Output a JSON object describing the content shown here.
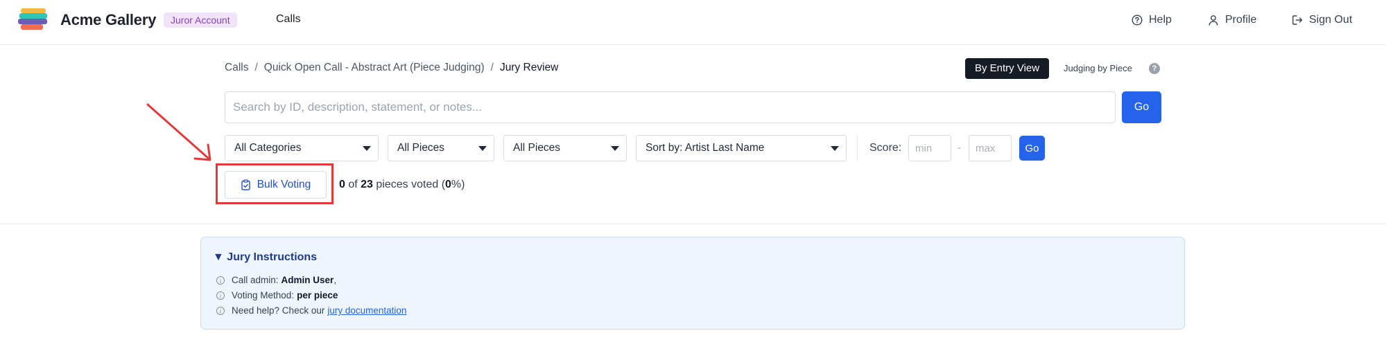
{
  "header": {
    "brand": "Acme Gallery",
    "account_badge": "Juror Account",
    "nav_calls": "Calls",
    "help": "Help",
    "profile": "Profile",
    "sign_out": "Sign Out"
  },
  "breadcrumb": {
    "calls": "Calls",
    "call_name": "Quick Open Call - Abstract Art (Piece Judging)",
    "current": "Jury Review"
  },
  "view": {
    "toggle_label": "By Entry View",
    "judging_label": "Judging by Piece",
    "help_glyph": "?"
  },
  "search": {
    "placeholder": "Search by ID, description, statement, or notes...",
    "value": "",
    "go_label": "Go"
  },
  "filters": {
    "category": "All Categories",
    "pieces_1": "All Pieces",
    "pieces_2": "All Pieces",
    "sort": "Sort by: Artist Last Name",
    "score_label": "Score:",
    "score_min_placeholder": "min",
    "score_max_placeholder": "max",
    "score_dash": "-",
    "go_label": "Go"
  },
  "voting": {
    "bulk_label": "Bulk Voting",
    "voted": "0",
    "of_text": "of",
    "total": "23",
    "pieces_text": "pieces voted (",
    "percent": "0",
    "percent_suffix": "%)"
  },
  "instructions": {
    "title": "Jury Instructions",
    "admin_label": "Call admin:",
    "admin_value": "Admin User",
    "admin_suffix": ",",
    "method_label": "Voting Method:",
    "method_value": "per piece",
    "help_label": "Need help? Check our",
    "help_link": "jury documentation"
  },
  "colors": {
    "accent": "#2563eb",
    "badge_bg": "#f1e4fa",
    "badge_text": "#8b3fc4",
    "highlight": "#e5383b",
    "instructions_bg": "#eef5fd"
  }
}
